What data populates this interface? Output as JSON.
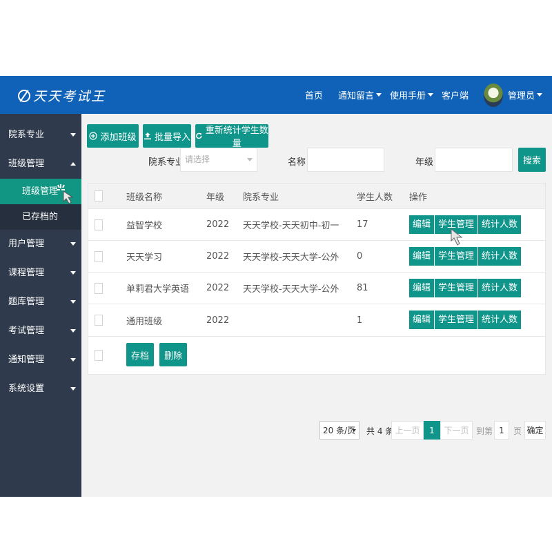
{
  "header": {
    "logo_text": "天天考试王",
    "nav": [
      "首页",
      "通知留言",
      "使用手册",
      "客户端"
    ],
    "user": "管理员"
  },
  "sidebar": {
    "items": [
      {
        "label": "院系专业"
      },
      {
        "label": "班级管理",
        "expanded": true,
        "children": [
          {
            "label": "班级管理",
            "active": true
          },
          {
            "label": "已存档的"
          }
        ]
      },
      {
        "label": "用户管理"
      },
      {
        "label": "课程管理"
      },
      {
        "label": "题库管理"
      },
      {
        "label": "考试管理"
      },
      {
        "label": "通知管理"
      },
      {
        "label": "系统设置"
      }
    ]
  },
  "toolbar": {
    "add_class": "添加班级",
    "batch_import": "批量导入",
    "recount": "重新统计学生数量"
  },
  "filter": {
    "dept_label": "院系专业",
    "dept_placeholder": "请选择",
    "name_label": "名称",
    "grade_label": "年级",
    "search": "搜索"
  },
  "table": {
    "headers": [
      "班级名称",
      "年级",
      "院系专业",
      "学生人数",
      "操作"
    ],
    "rows": [
      {
        "name": "益智学校",
        "grade": "2022",
        "dept": "天天学校-天天初中-初一",
        "count": "17"
      },
      {
        "name": "天天学习",
        "grade": "2022",
        "dept": "天天学校-天天大学-公外",
        "count": "0"
      },
      {
        "name": "单莉君大学英语",
        "grade": "2022",
        "dept": "天天学校-天天大学-公外",
        "count": "81"
      },
      {
        "name": "通用班级",
        "grade": "2022",
        "dept": "",
        "count": "1"
      }
    ],
    "ops": [
      "编辑",
      "学生管理",
      "统计人数"
    ],
    "archive": "存档",
    "delete": "删除"
  },
  "pagination": {
    "page_size": "20 条/页",
    "total": "共 4 条",
    "prev": "上一页",
    "current": "1",
    "next": "下一页",
    "goto_label": "到第",
    "goto_value": "1",
    "page_unit": "页",
    "confirm": "确定"
  },
  "colors": {
    "header": "#0f62b8",
    "sidebar": "#2f3b4c",
    "accent": "#10958a"
  }
}
